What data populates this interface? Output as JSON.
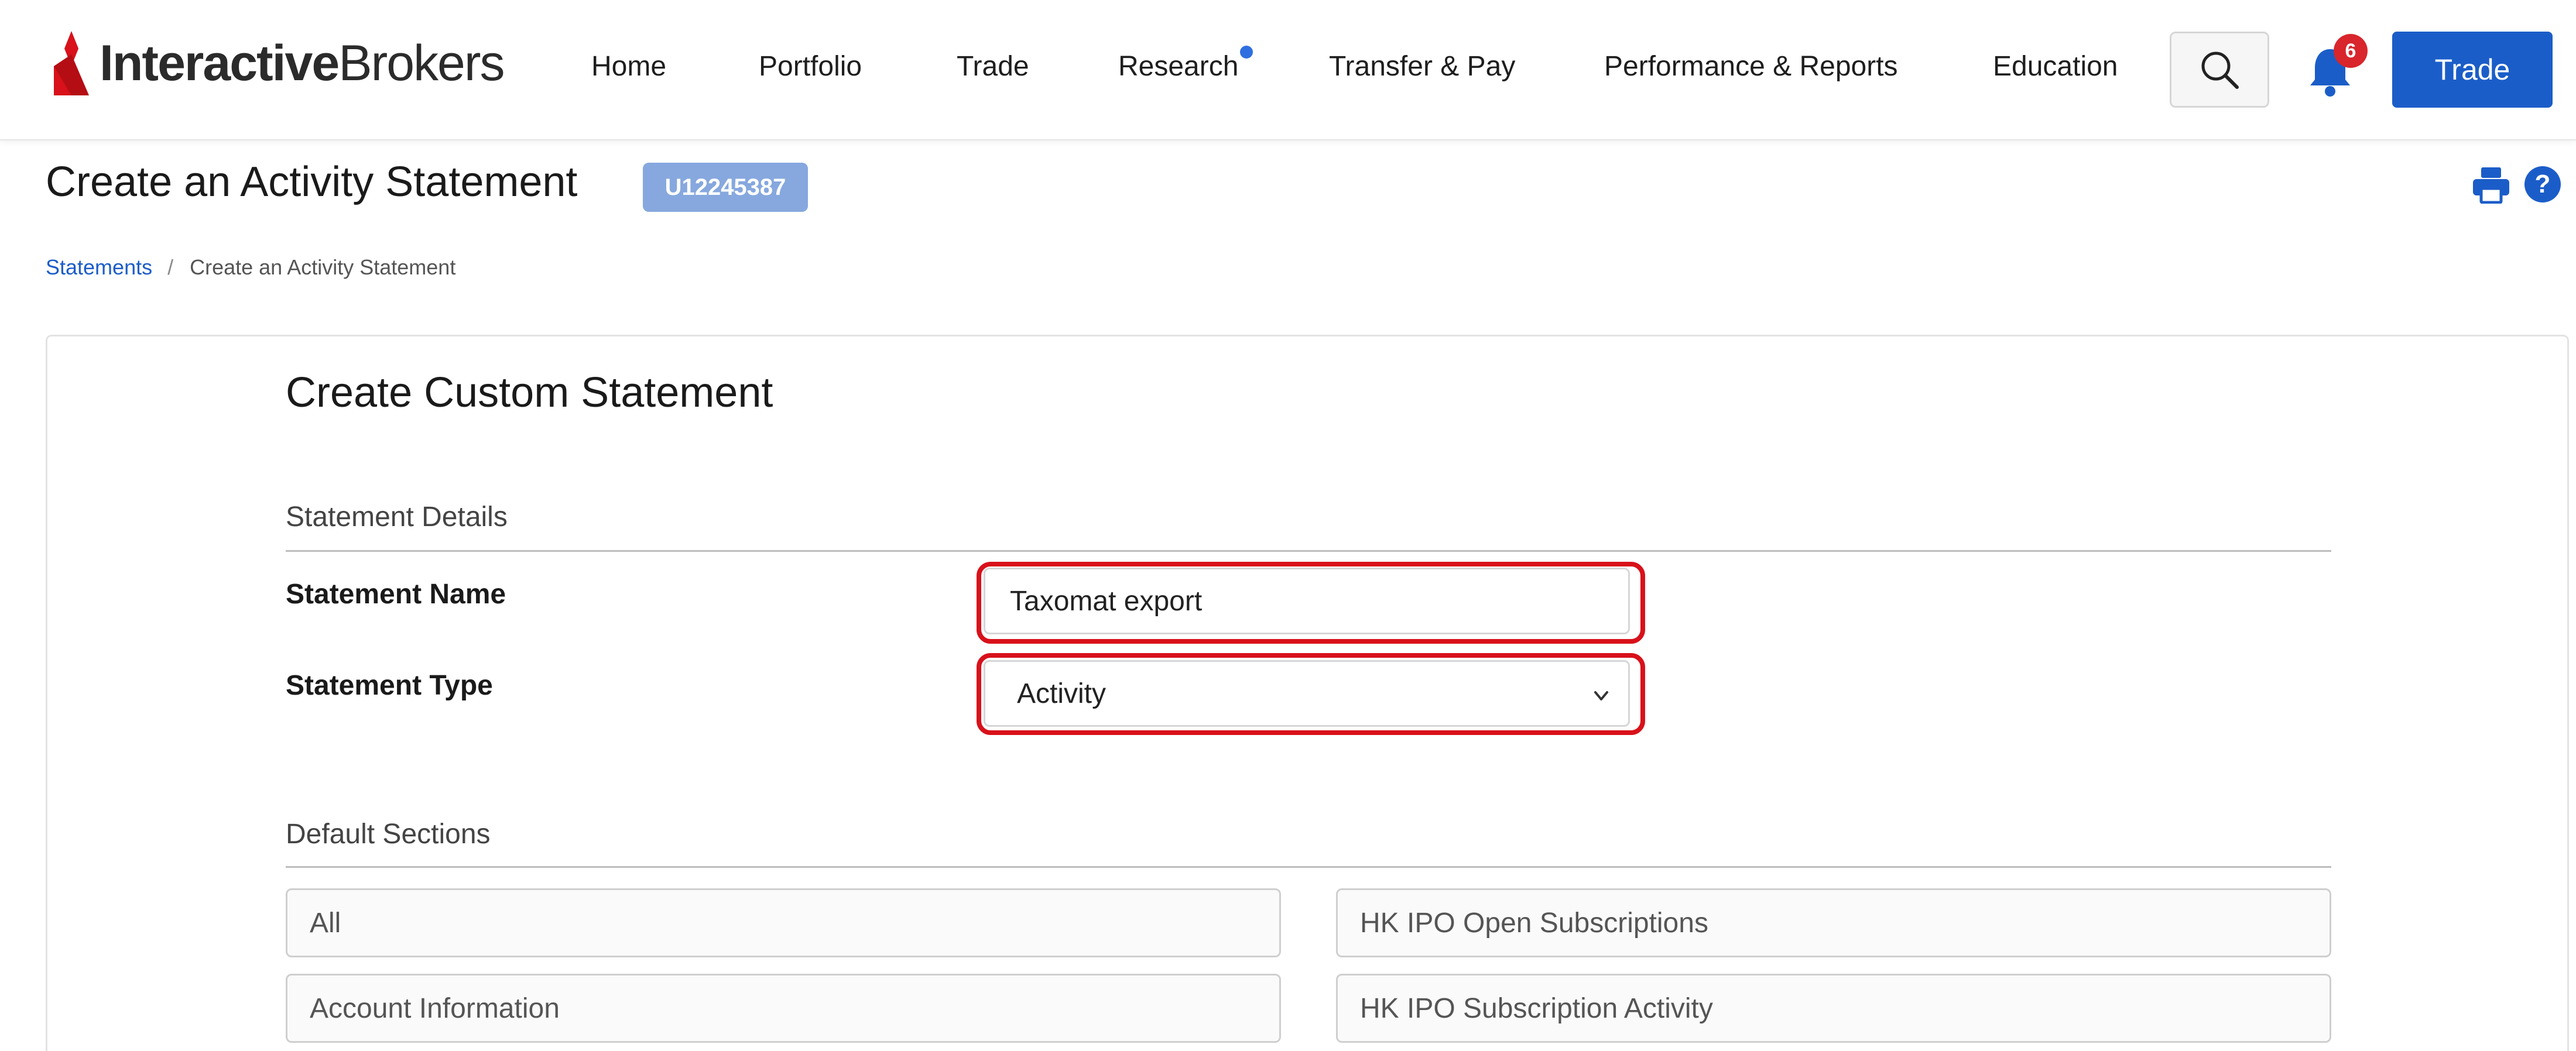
{
  "brand": {
    "logo_bold": "Interactive",
    "logo_regular": "Brokers"
  },
  "nav": {
    "items": [
      "Home",
      "Portfolio",
      "Trade",
      "Research",
      "Transfer & Pay",
      "Performance & Reports",
      "Education"
    ],
    "notification_count": "6",
    "trade_button": "Trade",
    "accent_color": "#1b5dc8"
  },
  "page": {
    "title": "Create an Activity Statement",
    "account_id": "U12245387",
    "help_glyph": "?"
  },
  "breadcrumb": {
    "parent": "Statements",
    "separator": "/",
    "current": "Create an Activity Statement"
  },
  "form": {
    "title": "Create Custom Statement",
    "details_section": "Statement Details",
    "name_label": "Statement Name",
    "name_value": "Taxomat export",
    "type_label": "Statement Type",
    "type_value": "Activity",
    "default_sections_title": "Default Sections",
    "sections": [
      "All",
      "HK IPO Open Subscriptions",
      "Account Information",
      "HK IPO Subscription Activity"
    ]
  }
}
